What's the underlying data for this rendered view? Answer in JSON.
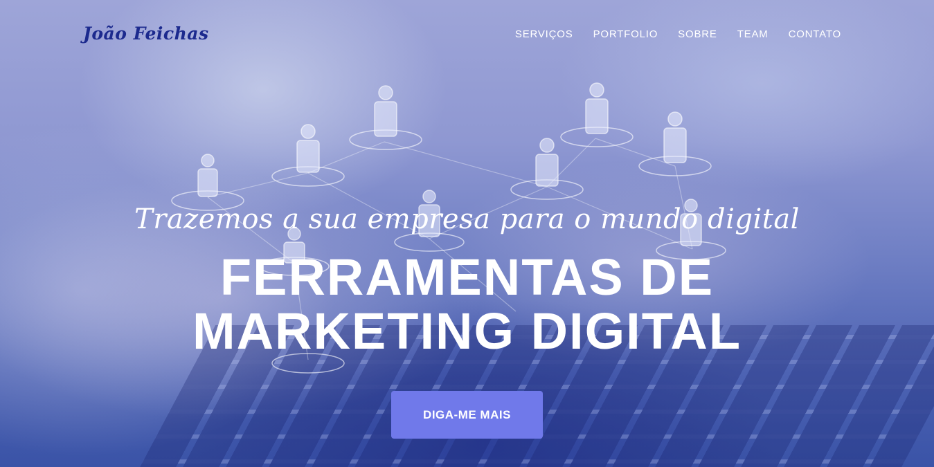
{
  "brand": {
    "name": "João Feichas"
  },
  "nav": {
    "items": [
      {
        "label": "SERVIÇOS"
      },
      {
        "label": "PORTFOLIO"
      },
      {
        "label": "SOBRE"
      },
      {
        "label": "TEAM"
      },
      {
        "label": "CONTATO"
      }
    ]
  },
  "hero": {
    "subheading": "Trazemos a sua empresa para o mundo digital",
    "heading_line1": "FERRAMENTAS DE",
    "heading_line2": "MARKETING DIGITAL",
    "cta_label": "DIGA-ME MAIS"
  },
  "colors": {
    "brand": "#1c2a8e",
    "cta": "#7079ea",
    "overlay": "#3a53a7"
  }
}
